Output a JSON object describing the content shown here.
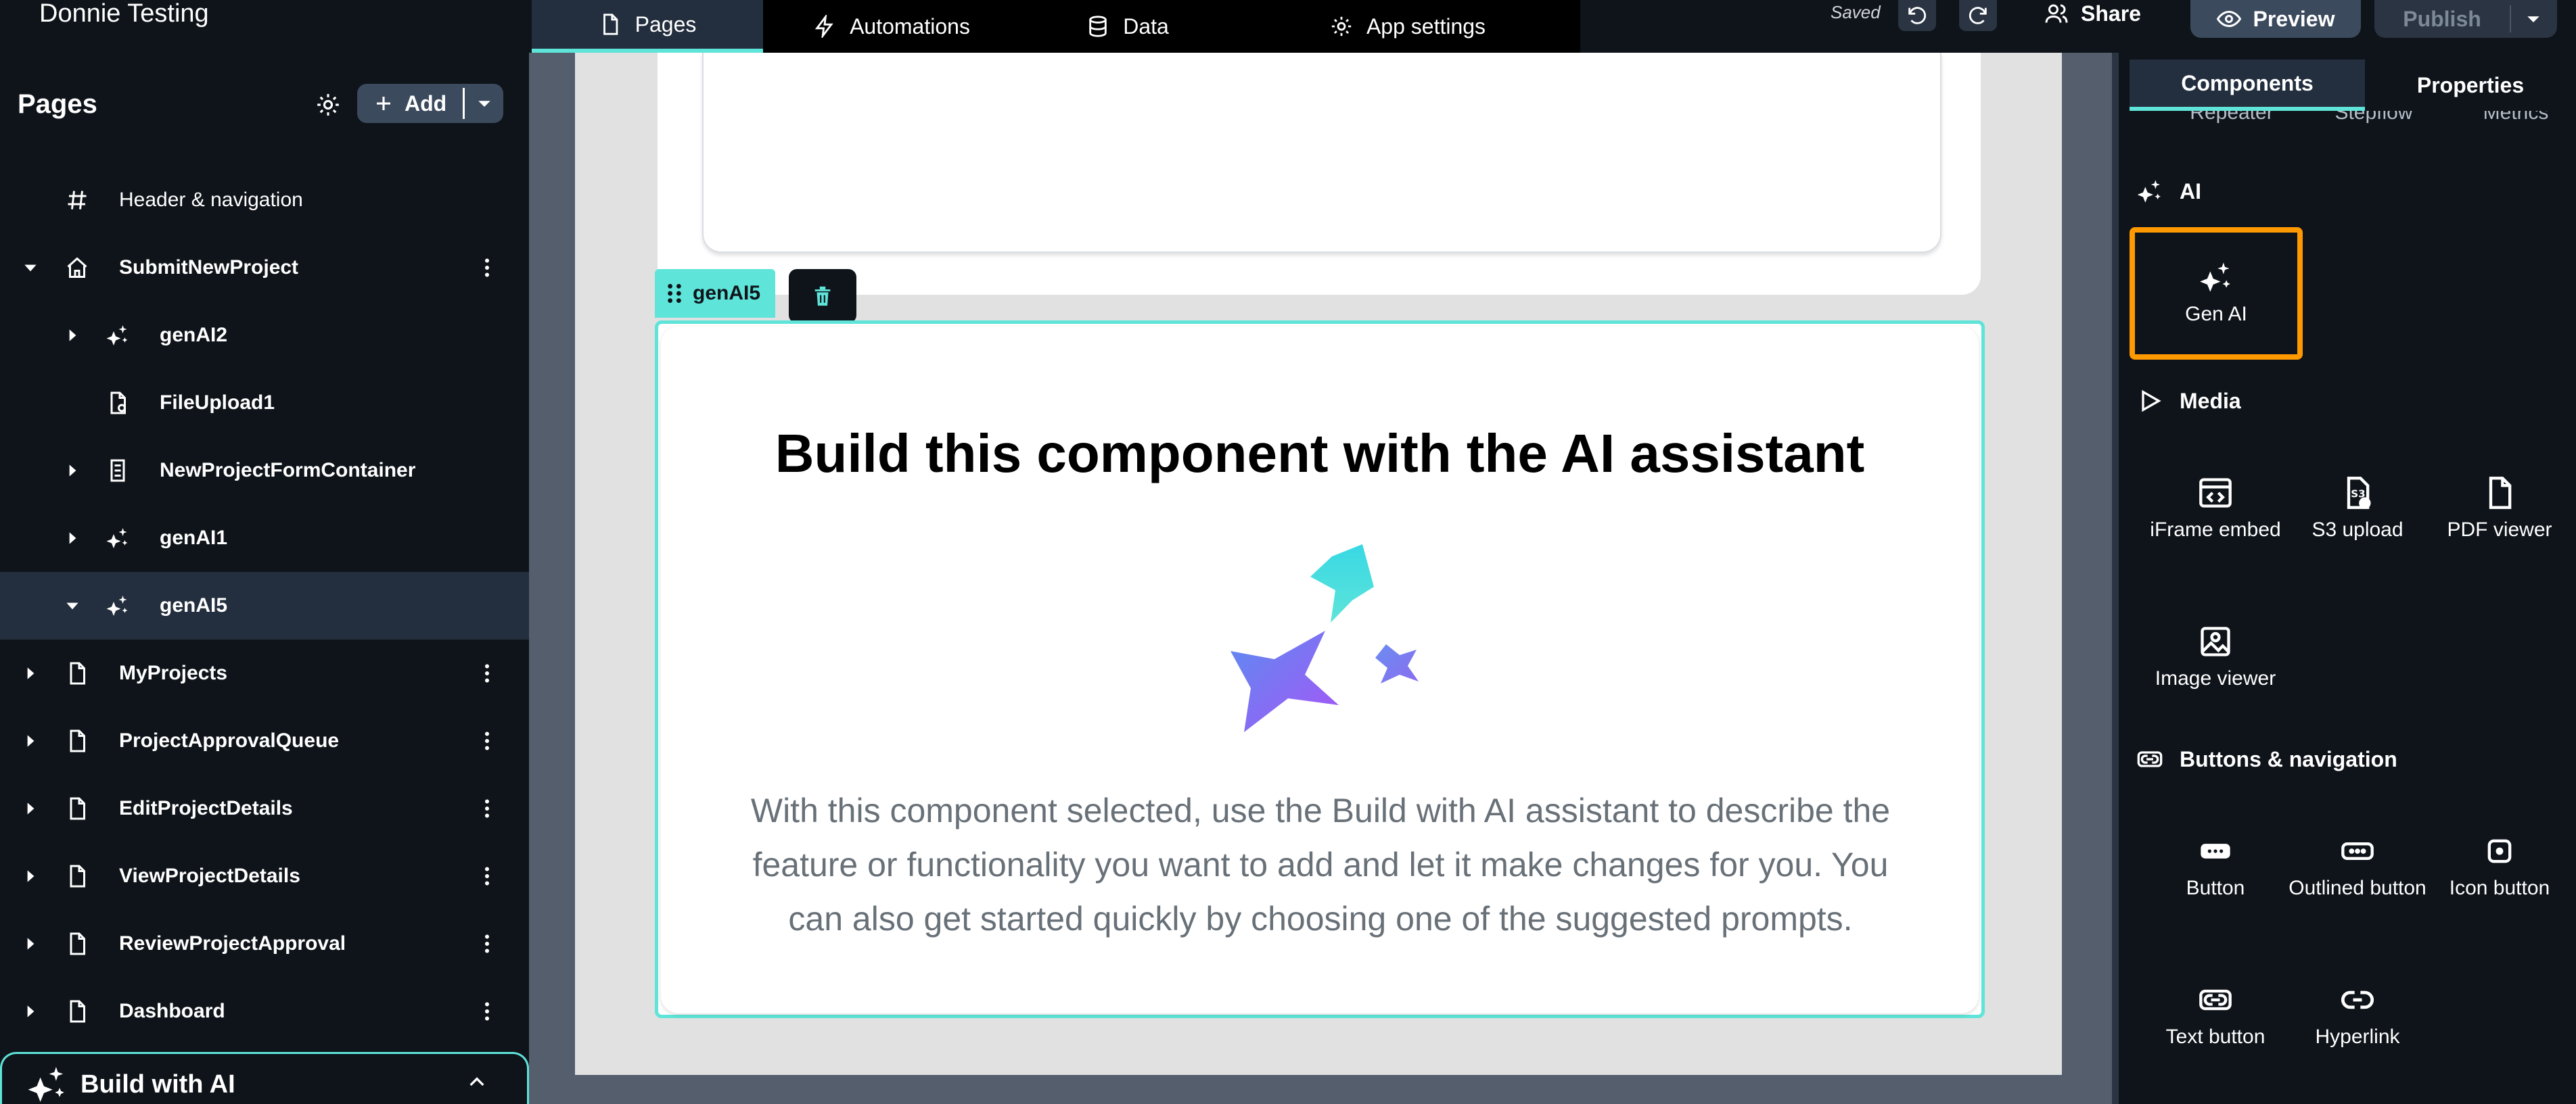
{
  "app": {
    "title": "Donnie Testing"
  },
  "topnav": {
    "tabs": [
      {
        "label": "Pages",
        "icon": "page-icon",
        "active": true
      },
      {
        "label": "Automations",
        "icon": "lightning-icon",
        "active": false
      },
      {
        "label": "Data",
        "icon": "database-icon",
        "active": false
      },
      {
        "label": "App settings",
        "icon": "gear-icon",
        "active": false
      }
    ],
    "saved_label": "Saved",
    "share_label": "Share",
    "preview_label": "Preview",
    "publish_label": "Publish"
  },
  "sidebar": {
    "title": "Pages",
    "add_label": "Add",
    "items": [
      {
        "label": "Header & navigation",
        "icon": "hash-icon",
        "level": 0
      },
      {
        "label": "SubmitNewProject",
        "icon": "home-icon",
        "level": 0,
        "expanded": true
      },
      {
        "label": "genAI2",
        "icon": "sparkle-icon",
        "level": 1
      },
      {
        "label": "FileUpload1",
        "icon": "file-upload-icon",
        "level": 1
      },
      {
        "label": "NewProjectFormContainer",
        "icon": "form-container-icon",
        "level": 1
      },
      {
        "label": "genAI1",
        "icon": "sparkle-icon",
        "level": 1
      },
      {
        "label": "genAI5",
        "icon": "sparkle-icon",
        "level": 1,
        "selected": true
      },
      {
        "label": "MyProjects",
        "icon": "page-icon",
        "level": 0
      },
      {
        "label": "ProjectApprovalQueue",
        "icon": "page-icon",
        "level": 0
      },
      {
        "label": "EditProjectDetails",
        "icon": "page-icon",
        "level": 0
      },
      {
        "label": "ViewProjectDetails",
        "icon": "page-icon",
        "level": 0
      },
      {
        "label": "ReviewProjectApproval",
        "icon": "page-icon",
        "level": 0
      },
      {
        "label": "Dashboard",
        "icon": "page-icon",
        "level": 0
      }
    ],
    "build_ai_label": "Build with AI"
  },
  "canvas": {
    "selected_tag": "genAI5",
    "gen_card": {
      "title": "Build this component with the AI assistant",
      "description": "With this component selected, use the Build with AI assistant to describe the feature or functionality you want to add and let it make changes for you. You can also get started quickly by choosing one of the suggested prompts."
    }
  },
  "rpanel": {
    "tabs": [
      {
        "label": "Components",
        "active": true
      },
      {
        "label": "Properties",
        "active": false
      }
    ],
    "cut_labels": [
      "Repeater",
      "Stepflow",
      "Metrics"
    ],
    "sections": {
      "ai": {
        "label": "AI",
        "items": [
          {
            "label": "Gen AI",
            "icon": "sparkle-icon"
          }
        ]
      },
      "media": {
        "label": "Media",
        "items": [
          {
            "label": "iFrame embed",
            "icon": "iframe-icon"
          },
          {
            "label": "S3 upload",
            "icon": "s3-upload-icon"
          },
          {
            "label": "PDF viewer",
            "icon": "pdf-icon"
          },
          {
            "label": "Image viewer",
            "icon": "image-icon"
          }
        ]
      },
      "buttons": {
        "label": "Buttons & navigation",
        "items": [
          {
            "label": "Button",
            "icon": "button-icon"
          },
          {
            "label": "Outlined button",
            "icon": "outlined-button-icon"
          },
          {
            "label": "Icon button",
            "icon": "icon-button-icon"
          },
          {
            "label": "Text button",
            "icon": "text-button-icon"
          },
          {
            "label": "Hyperlink",
            "icon": "link-icon"
          }
        ]
      }
    }
  },
  "colors": {
    "accent_teal": "#5ee4d9",
    "highlight_orange": "#ff9900",
    "bg_dark": "#0f141a",
    "selected_row": "#232f3e"
  }
}
